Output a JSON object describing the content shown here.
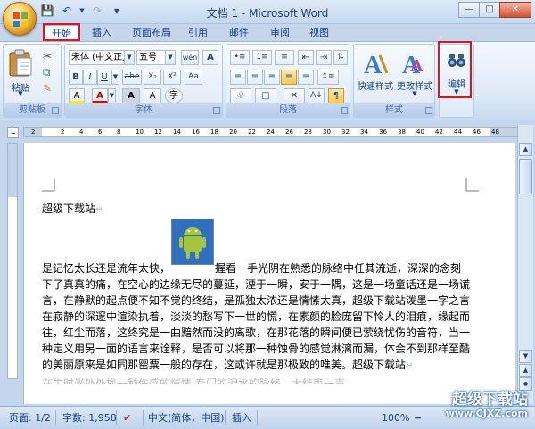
{
  "window": {
    "title": "文档 1 - Microsoft Word"
  },
  "tabs": [
    "开始",
    "插入",
    "页面布局",
    "引用",
    "邮件",
    "审阅",
    "视图"
  ],
  "ribbon": {
    "clipboard": {
      "paste_label": "粘贴",
      "group_label": "剪贴板"
    },
    "font": {
      "font_name": "宋体 (中文正文",
      "font_size": "五号",
      "wen_btn": "wén",
      "grow_btn": "A",
      "bold": "B",
      "italic": "I",
      "underline": "U",
      "strike": "abe",
      "sub": "X₂",
      "sup": "X²",
      "clear": "Aa",
      "font_color": "A",
      "highlight": "A",
      "char_shading": "A",
      "encircle": "字",
      "group_label": "字体"
    },
    "paragraph": {
      "group_label": "段落"
    },
    "styles": {
      "quick_label": "快速样式",
      "change_label": "更改样式",
      "group_label": "样式"
    },
    "editing": {
      "label": "编辑"
    }
  },
  "ruler": {
    "numbers": [
      "2",
      "2",
      "4",
      "6",
      "8",
      "10",
      "12",
      "14",
      "16",
      "18",
      "20",
      "22",
      "24",
      "26",
      "28",
      "30",
      "32",
      "34",
      "36",
      "38",
      "40",
      "42",
      "44",
      "46",
      "48"
    ]
  },
  "document": {
    "heading": "超级下载站",
    "body": [
      "是记忆太长还是流年太快，",
      "握看一手光阴在熟悉的脉络中任其流逝，深深的念刻",
      "下了真真的痛，在空心的边缘无尽的蔓延，湮于一瞬，安于一隅，这是一场童话还是一场谎",
      "言，在静默的起点便不知不觉的终结，是孤独太浓还是情愫太真，超级下载站泼墨一字之言",
      "在寂静的深邃中渲染执着，淡淡的愁写下一世的慌，在素颜的脸庞留下怜人的泪痕，缘起而",
      "往，红尘而落，这终究是一曲黯然而没的离歌，在那花落的瞬间便已萦绕忧伤的音符，当一",
      "种定义用另一面的语言来诠释，是否可以将那一种蚀骨的感觉淋漓而漏，体会不到那样至酷",
      "的美丽原来是如同那罂粟一般的存在，这或许就是那极致的唯美。超级下载站",
      "在生时光处处找一种伤感的情愫 专门的泪水的脉络，大结束一声"
    ]
  },
  "status": {
    "page": "页面: 1/2",
    "words": "字数: 1,958",
    "lang": "中文(简体，中国)",
    "mode": "插入",
    "zoom": "100%"
  },
  "watermark": {
    "big": "超级下载站",
    "small": "www.CJXZ.com"
  }
}
